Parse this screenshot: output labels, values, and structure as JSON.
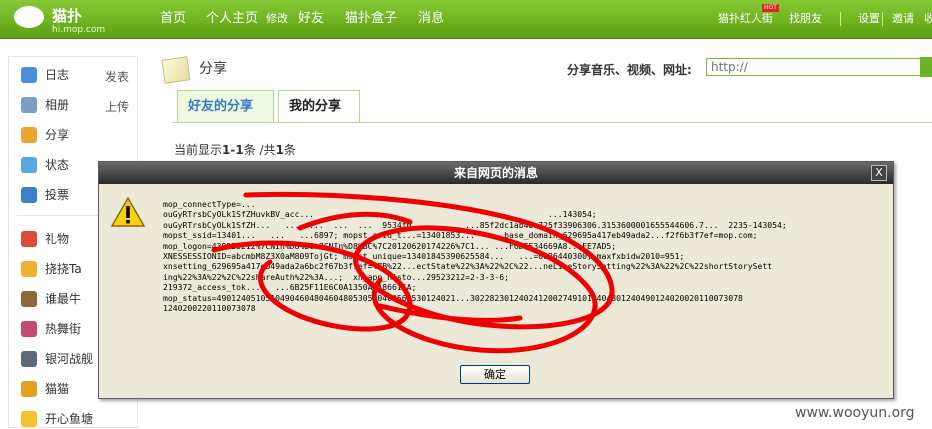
{
  "header": {
    "logo_text": "猫扑",
    "logo_sub": "hi.mop.com",
    "nav": [
      "首页",
      "个人主页",
      "修改",
      "好友",
      "猫扑盒子",
      "消息"
    ],
    "right_links": [
      "猫扑红人街",
      "找朋友",
      "设置",
      "邀请",
      "收"
    ],
    "hot_badge": "HOT"
  },
  "sidebar": {
    "items": [
      {
        "label": "日志",
        "action": "发表",
        "icon": "diary-icon",
        "color": "#4a8fd8"
      },
      {
        "label": "相册",
        "action": "上传",
        "icon": "photo-icon",
        "color": "#7a9ec4"
      },
      {
        "label": "分享",
        "icon": "share-icon",
        "color": "#e8a530"
      },
      {
        "label": "状态",
        "icon": "status-icon",
        "color": "#5aa6e0"
      },
      {
        "label": "投票",
        "icon": "vote-icon",
        "color": "#3f7fc9"
      },
      {
        "label": "礼物",
        "icon": "gift-icon",
        "color": "#d94b3b"
      },
      {
        "label": "挠挠Ta",
        "icon": "poke-icon",
        "color": "#f0b030"
      },
      {
        "label": "谁最牛",
        "icon": "who-icon",
        "color": "#8b6a3d"
      },
      {
        "label": "热舞街",
        "icon": "dance-icon",
        "color": "#c44a6d"
      },
      {
        "label": "银河战舰",
        "icon": "ship-icon",
        "color": "#5b6b7c"
      },
      {
        "label": "猫猫",
        "icon": "cat-icon",
        "color": "#e0a020"
      },
      {
        "label": "开心鱼塘",
        "icon": "fish-icon",
        "color": "#f2c32c"
      }
    ]
  },
  "main": {
    "title": "分享",
    "share_label": "分享音乐、视频、网址:",
    "url_placeholder": "http://",
    "tabs": [
      "好友的分享",
      "我的分享"
    ],
    "count_prefix": "当前显示",
    "count_range": "1-1",
    "count_mid": "条  /共",
    "count_total": "1",
    "count_suffix": "条"
  },
  "dialog": {
    "title": "来自网页的消息",
    "close": "X",
    "message": "mop_connectType=...\nouGyRTrsbCyOLk1SfZHuvkBV_acc...                                                ...143054;\nouGyRTrsbCyOLk1SfZH...   ...  ...  ...  ...  9534f0   ...     ...85f2dc1ab4be725f33906306.3153600001655544606.7...  2235-143054;\nmopst_ssid=13401...   ...   ...6897; mopst_ssid_t...=13401853...   ...base_domain_629695a417eb49ada2...f2f6b3f7ef=mop.com;\nmop_logon=439523212%7CNIn%D8%BC%7CNIn%D8%BC%7C20120620174226%7C1... ...F6DFE34669A8...FE7AD5;\nXNESSESSIONID=abcmbM8Z3X0aM809TojGt; mopst_unique=13401845390625584...   ...=0086440300; maxfxbidw2010=951;\nxnsetting_629695a417eb49ada2a6bc2f67b3f7ef=%7B%22...ectState%22%3A%22%2C%22...neLineStorySetting%22%3A%22%2C%22shortStorySett\ning%22%3A%22%2C%22shareAuth%22%3A...;  xn_app_histo...29523212=2-3-3-6;\n219372_access_tok...   ...6B25F11E6C0A1350A1A86615A;\nmop_status=4901240510510490460480460480530500460560530124021...30228230124024120027491012404801240490124020020110073078\n1240200220110073078",
    "ok": "确定"
  },
  "watermark": "www.wooyun.org",
  "colors": {
    "header_green": "#6fb21f",
    "link_blue": "#3a7cc4",
    "dialog_bg": "#ece9d8",
    "scribble_red": "#ee0000"
  }
}
